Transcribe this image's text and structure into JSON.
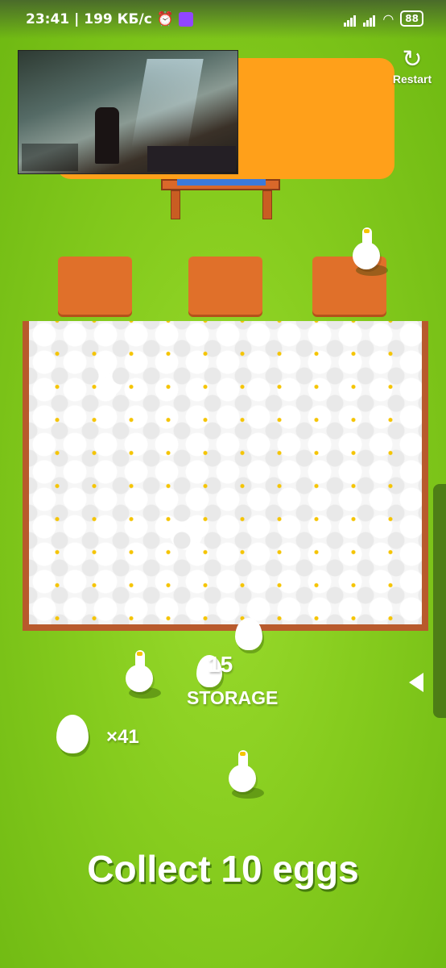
{
  "status_bar": {
    "time": "23:41",
    "network_speed": "| 199 КБ/с",
    "alarm_icon": "alarm-icon",
    "app_icon": "twitch-icon",
    "battery": "88"
  },
  "stream": {
    "preview_icon": "video-stream-preview"
  },
  "restart": {
    "label": "Restart",
    "icon": "restart-icon"
  },
  "storage": {
    "count": "15",
    "label": "STORAGE"
  },
  "inventory": {
    "egg_count": "×41"
  },
  "objective": {
    "text": "Collect 10 eggs"
  },
  "colors": {
    "grass": "#86cc1e",
    "orange_zone": "#ffa01a",
    "pad": "#e0702a",
    "fence": "#b85a2c",
    "goose": "#ffffff",
    "beak": "#f5c400"
  }
}
